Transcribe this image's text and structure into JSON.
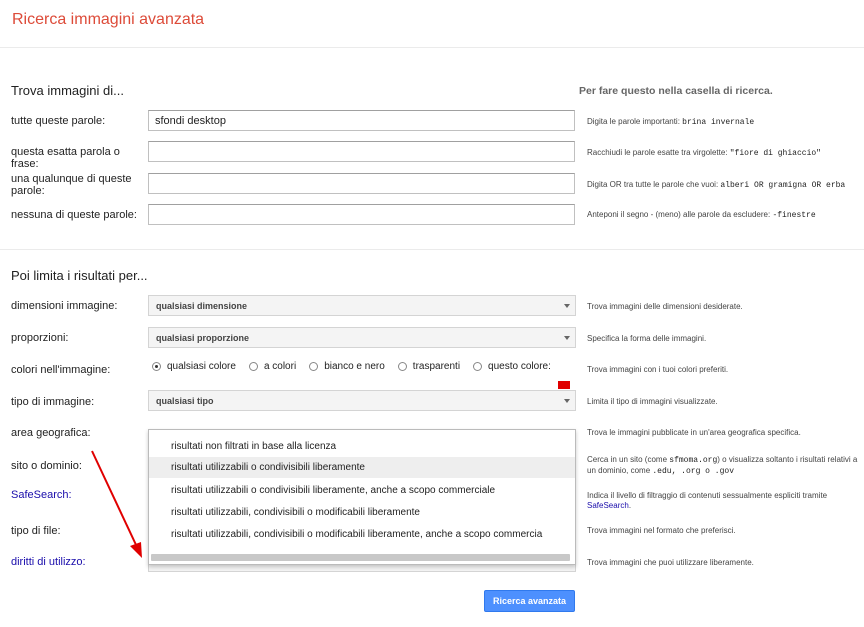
{
  "page_title": "Ricerca immagini avanzata",
  "find_section": {
    "title": "Trova immagini di...",
    "right_heading": "Per fare questo nella casella di ricerca.",
    "rows": [
      {
        "label": "tutte queste parole:",
        "value": "sfondi desktop",
        "hint_text": "Digita le parole importanti: ",
        "hint_code": "brina invernale"
      },
      {
        "label": "questa esatta parola o frase:",
        "value": "",
        "hint_text": "Racchiudi le parole esatte tra virgolette: ",
        "hint_code": "\"fiore di ghiaccio\""
      },
      {
        "label": "una qualunque di queste parole:",
        "value": "",
        "hint_text": "Digita OR tra tutte le parole che vuoi: ",
        "hint_code": "alberi OR gramigna OR erba"
      },
      {
        "label": "nessuna di queste parole:",
        "value": "",
        "hint_text": "Anteponi il segno - (meno) alle parole da escludere: ",
        "hint_code": "-finestre"
      }
    ]
  },
  "limit_section": {
    "title": "Poi limita i risultati per...",
    "image_size": {
      "label": "dimensioni immagine:",
      "value": "qualsiasi dimensione",
      "hint": "Trova immagini delle dimensioni desiderate."
    },
    "aspect_ratio": {
      "label": "proporzioni:",
      "value": "qualsiasi proporzione",
      "hint": "Specifica la forma delle immagini."
    },
    "colors": {
      "label": "colori nell'immagine:",
      "options": [
        "qualsiasi colore",
        "a colori",
        "bianco e nero",
        "trasparenti",
        "questo colore:"
      ],
      "selected": 0,
      "hint": "Trova immagini con i tuoi colori preferiti."
    },
    "image_type": {
      "label": "tipo di immagine:",
      "value": "qualsiasi tipo",
      "hint": "Limita il tipo di immagini visualizzate."
    },
    "region": {
      "label": "area geografica:",
      "hint": "Trova le immagini pubblicate in un'area geografica specifica."
    },
    "site": {
      "label": "sito o dominio:",
      "hint_a": "Cerca in un sito (come ",
      "hint_code_a": "sfmoma.org",
      "hint_b": ") o visualizza soltanto i risultati relativi a un dominio, come ",
      "hint_code_b": ".edu, .org o .gov"
    },
    "safesearch": {
      "label": "SafeSearch:",
      "hint": "Indica il livello di filtraggio di contenuti sessualmente espliciti tramite ",
      "hint_link": "SafeSearch",
      "hint_end": "."
    },
    "file_type": {
      "label": "tipo di file:",
      "hint": "Trova immagini nel formato che preferisci."
    },
    "usage_rights": {
      "label": "diritti di utilizzo:",
      "value": "risultati non filtrati in base alla licenza",
      "hint": "Trova immagini che puoi utilizzare liberamente."
    }
  },
  "usage_dropdown": {
    "options": [
      "risultati non filtrati in base alla licenza",
      "risultati utilizzabili o condivisibili liberamente",
      "risultati utilizzabili o condivisibili liberamente, anche a scopo commerciale",
      "risultati utilizzabili, condivisibili o modificabili liberamente",
      "risultati utilizzabili, condivisibili o modificabili liberamente, anche a scopo commercia"
    ],
    "highlighted": 1
  },
  "submit_label": "Ricerca avanzata",
  "colors": {
    "title": "#dd4b39",
    "link": "#1a0dab",
    "button": "#4d90fe",
    "annotation_arrow": "#e00000"
  }
}
